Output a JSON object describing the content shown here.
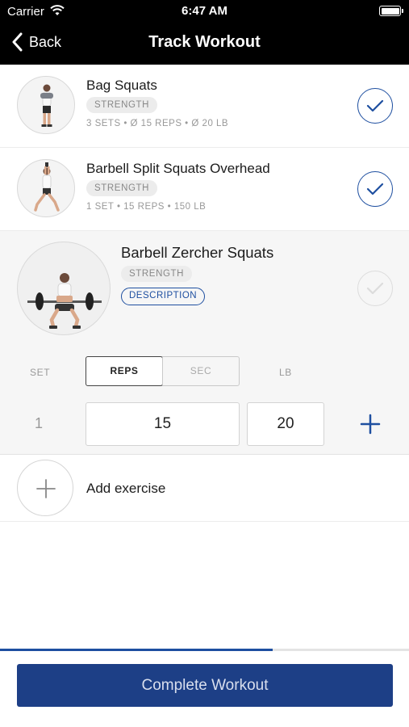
{
  "status_bar": {
    "carrier": "Carrier",
    "time": "6:47 AM"
  },
  "nav": {
    "back_label": "Back",
    "title": "Track Workout"
  },
  "exercises": [
    {
      "name": "Bag Squats",
      "tag": "STRENGTH",
      "meta": "3 SETS • Ø 15 REPS • Ø 20 LB",
      "completed": true
    },
    {
      "name": "Barbell Split Squats Overhead",
      "tag": "STRENGTH",
      "meta": "1 SET • 15 REPS • 150 LB",
      "completed": true
    }
  ],
  "active_exercise": {
    "name": "Barbell Zercher Squats",
    "tag": "STRENGTH",
    "description_label": "DESCRIPTION",
    "completed": false,
    "columns": {
      "set": "SET",
      "reps": "REPS",
      "sec": "SEC",
      "lb": "LB"
    },
    "selected_mode": "REPS",
    "sets": [
      {
        "set": "1",
        "reps": "15",
        "lb": "20"
      }
    ]
  },
  "add_exercise_label": "Add exercise",
  "progress_fraction": 0.667,
  "complete_button_label": "Complete Workout",
  "colors": {
    "accent": "#1e4fa0",
    "button": "#1d3f86",
    "nav": "#000000"
  }
}
